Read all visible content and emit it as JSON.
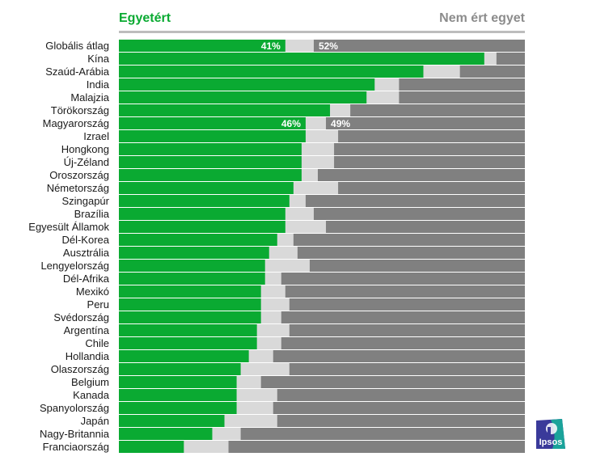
{
  "chart_data": {
    "type": "bar",
    "orientation": "horizontal-stacked",
    "legend": {
      "agree_label": "Egyetért",
      "disagree_label": "Nem ért egyet",
      "placement": "top"
    },
    "colors": {
      "agree": "#0aaa32",
      "neutral": "#d9d9d9",
      "disagree": "#808080",
      "rule": "#bdbdbd"
    },
    "xlim": [
      0,
      100
    ],
    "categories": [
      "Globális átlag",
      "Kína",
      "Szaúd-Arábia",
      "India",
      "Malajzia",
      "Törökország",
      "Magyarország",
      "Izrael",
      "Hongkong",
      "Új-Zéland",
      "Oroszország",
      "Németország",
      "Szingapúr",
      "Brazília",
      "Egyesült Államok",
      "Dél-Korea",
      "Ausztrália",
      "Lengyelország",
      "Dél-Afrika",
      "Mexikó",
      "Peru",
      "Svédország",
      "Argentína",
      "Chile",
      "Hollandia",
      "Olaszország",
      "Belgium",
      "Kanada",
      "Spanyolország",
      "Japán",
      "Nagy-Britannia",
      "Franciaország"
    ],
    "series": [
      {
        "name": "Egyetért",
        "values": [
          41,
          90,
          75,
          63,
          61,
          52,
          46,
          46,
          45,
          45,
          45,
          43,
          42,
          41,
          41,
          39,
          37,
          36,
          36,
          35,
          35,
          35,
          34,
          34,
          32,
          30,
          29,
          29,
          29,
          26,
          23,
          16
        ]
      },
      {
        "name": "Nem ért egyet",
        "values": [
          52,
          7,
          16,
          31,
          31,
          43,
          49,
          46,
          47,
          47,
          51,
          46,
          54,
          52,
          49,
          57,
          56,
          53,
          60,
          59,
          58,
          60,
          58,
          60,
          62,
          58,
          65,
          61,
          62,
          61,
          70,
          73
        ]
      }
    ],
    "data_labels": [
      {
        "category": "Globális átlag",
        "agree": "41%",
        "disagree": "52%"
      },
      {
        "category": "Magyarország",
        "agree": "46%",
        "disagree": "49%"
      }
    ]
  },
  "logo": {
    "text": "Ipsos"
  }
}
